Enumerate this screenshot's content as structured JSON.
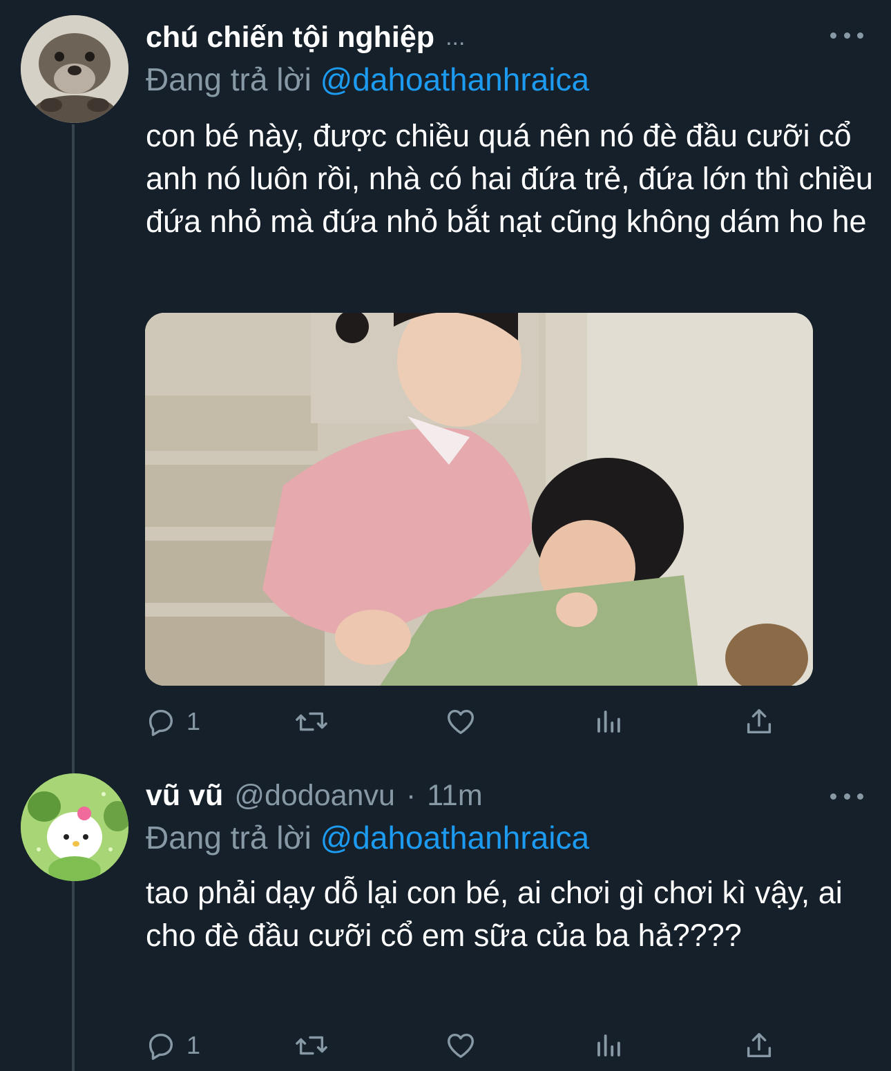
{
  "tweets": [
    {
      "display_name": "chú chiến tội nghiệp",
      "header_suffix": "...",
      "reply_prefix": "Đang trả lời",
      "reply_mention": "@dahoathanhraica",
      "text": "con bé này, được chiều quá nên nó đè đầu cưỡi cổ anh nó luôn rồi, nhà có hai đứa trẻ, đứa lớn thì chiều đứa nhỏ mà đứa nhỏ bắt nạt cũng không dám ho he",
      "reply_count": "1"
    },
    {
      "display_name": "vũ vũ",
      "handle": "@dodoanvu",
      "separator": "·",
      "time": "11m",
      "reply_prefix": "Đang trả lời",
      "reply_mention": "@dahoathanhraica",
      "text": "tao phải dạy dỗ lại con bé, ai chơi gì chơi kì vậy, ai cho đè đầu cưỡi cổ em sữa của ba hả????",
      "reply_count": "1"
    }
  ],
  "icons": {
    "reply": "reply-icon",
    "retweet": "retweet-icon",
    "like": "heart-icon",
    "stats": "analytics-icon",
    "share": "share-icon",
    "more": "more-icon"
  },
  "colors": {
    "background": "#15202b",
    "secondary_text": "#8899a6",
    "link": "#1d9bf0",
    "thread_line": "#38444d"
  }
}
